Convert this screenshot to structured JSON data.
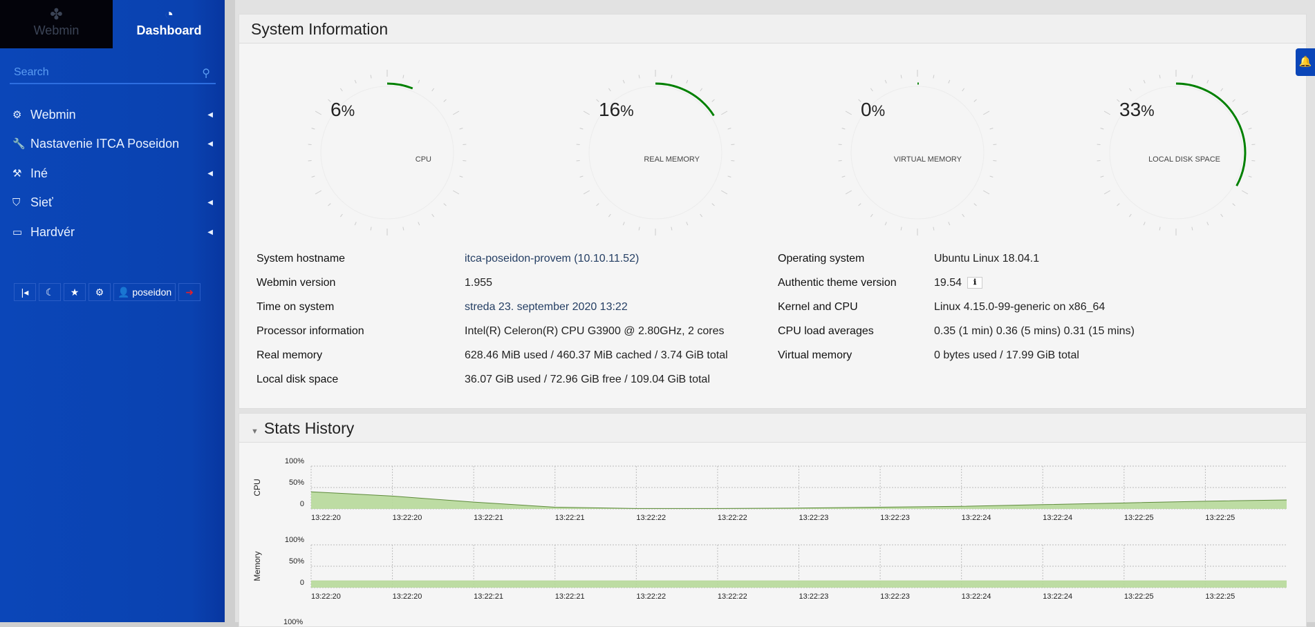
{
  "sidebar": {
    "tabs": [
      {
        "label": "Webmin",
        "icon": "webmin-logo-icon"
      },
      {
        "label": "Dashboard",
        "icon": "dashboard-icon",
        "active": true
      }
    ],
    "search_placeholder": "Search",
    "items": [
      {
        "label": "Webmin",
        "icon": "gear-icon"
      },
      {
        "label": "Nastavenie ITCA Poseidon",
        "icon": "wrench-icon"
      },
      {
        "label": "Iné",
        "icon": "gavel-icon"
      },
      {
        "label": "Sieť",
        "icon": "shield-icon"
      },
      {
        "label": "Hardvér",
        "icon": "hdd-icon"
      }
    ],
    "user": "poseidon"
  },
  "system_info": {
    "title": "System Information",
    "gauges": [
      {
        "label": "CPU",
        "value": 6
      },
      {
        "label": "REAL MEMORY",
        "value": 16
      },
      {
        "label": "VIRTUAL MEMORY",
        "value": 0
      },
      {
        "label": "LOCAL DISK SPACE",
        "value": 33
      }
    ],
    "gauge_color": "#008000",
    "left": [
      {
        "label": "System hostname",
        "value": "itca-poseidon-provem (10.10.11.52)"
      },
      {
        "label": "Webmin version",
        "value": "1.955"
      },
      {
        "label": "Time on system",
        "value": "streda 23. september 2020 13:22"
      },
      {
        "label": "Processor information",
        "value": "Intel(R) Celeron(R) CPU G3900 @ 2.80GHz, 2 cores"
      },
      {
        "label": "Real memory",
        "value": "628.46 MiB used / 460.37 MiB cached / 3.74 GiB total"
      },
      {
        "label": "Local disk space",
        "value": "36.07 GiB used / 72.96 GiB free / 109.04 GiB total"
      }
    ],
    "right": [
      {
        "label": "Operating system",
        "value": "Ubuntu Linux 18.04.1"
      },
      {
        "label": "Authentic theme version",
        "value": "19.54"
      },
      {
        "label": "Kernel and CPU",
        "value": "Linux 4.15.0-99-generic on x86_64"
      },
      {
        "label": "CPU load averages",
        "value": "0.35 (1 min) 0.36 (5 mins) 0.31 (15 mins)"
      },
      {
        "label": "Virtual memory",
        "value": "0 bytes used / 17.99 GiB total"
      }
    ]
  },
  "stats": {
    "title": "Stats History",
    "third_chart_top_label": "100%"
  },
  "chart_data": [
    {
      "type": "area",
      "ylabel": "CPU",
      "yticks": [
        "100%",
        "50%",
        "0"
      ],
      "ylim": [
        0,
        100
      ],
      "fill": "#b7d99a",
      "line": "#5d8a3a",
      "x": [
        "13:22:20",
        "13:22:20",
        "13:22:21",
        "13:22:21",
        "13:22:22",
        "13:22:22",
        "13:22:23",
        "13:22:23",
        "13:22:24",
        "13:22:24",
        "13:22:25",
        "13:22:25"
      ],
      "values": [
        40,
        30,
        16,
        4,
        1,
        1,
        2,
        4,
        6,
        10,
        14,
        18,
        21
      ]
    },
    {
      "type": "area",
      "ylabel": "Memory",
      "yticks": [
        "100%",
        "50%",
        "0"
      ],
      "ylim": [
        0,
        100
      ],
      "fill": "#b7d99a",
      "line": "#b7d99a",
      "x": [
        "13:22:20",
        "13:22:20",
        "13:22:21",
        "13:22:21",
        "13:22:22",
        "13:22:22",
        "13:22:23",
        "13:22:23",
        "13:22:24",
        "13:22:24",
        "13:22:25",
        "13:22:25"
      ],
      "values": [
        16,
        16,
        16,
        16,
        16,
        16,
        16,
        16,
        16,
        16,
        16,
        16,
        16
      ]
    }
  ]
}
